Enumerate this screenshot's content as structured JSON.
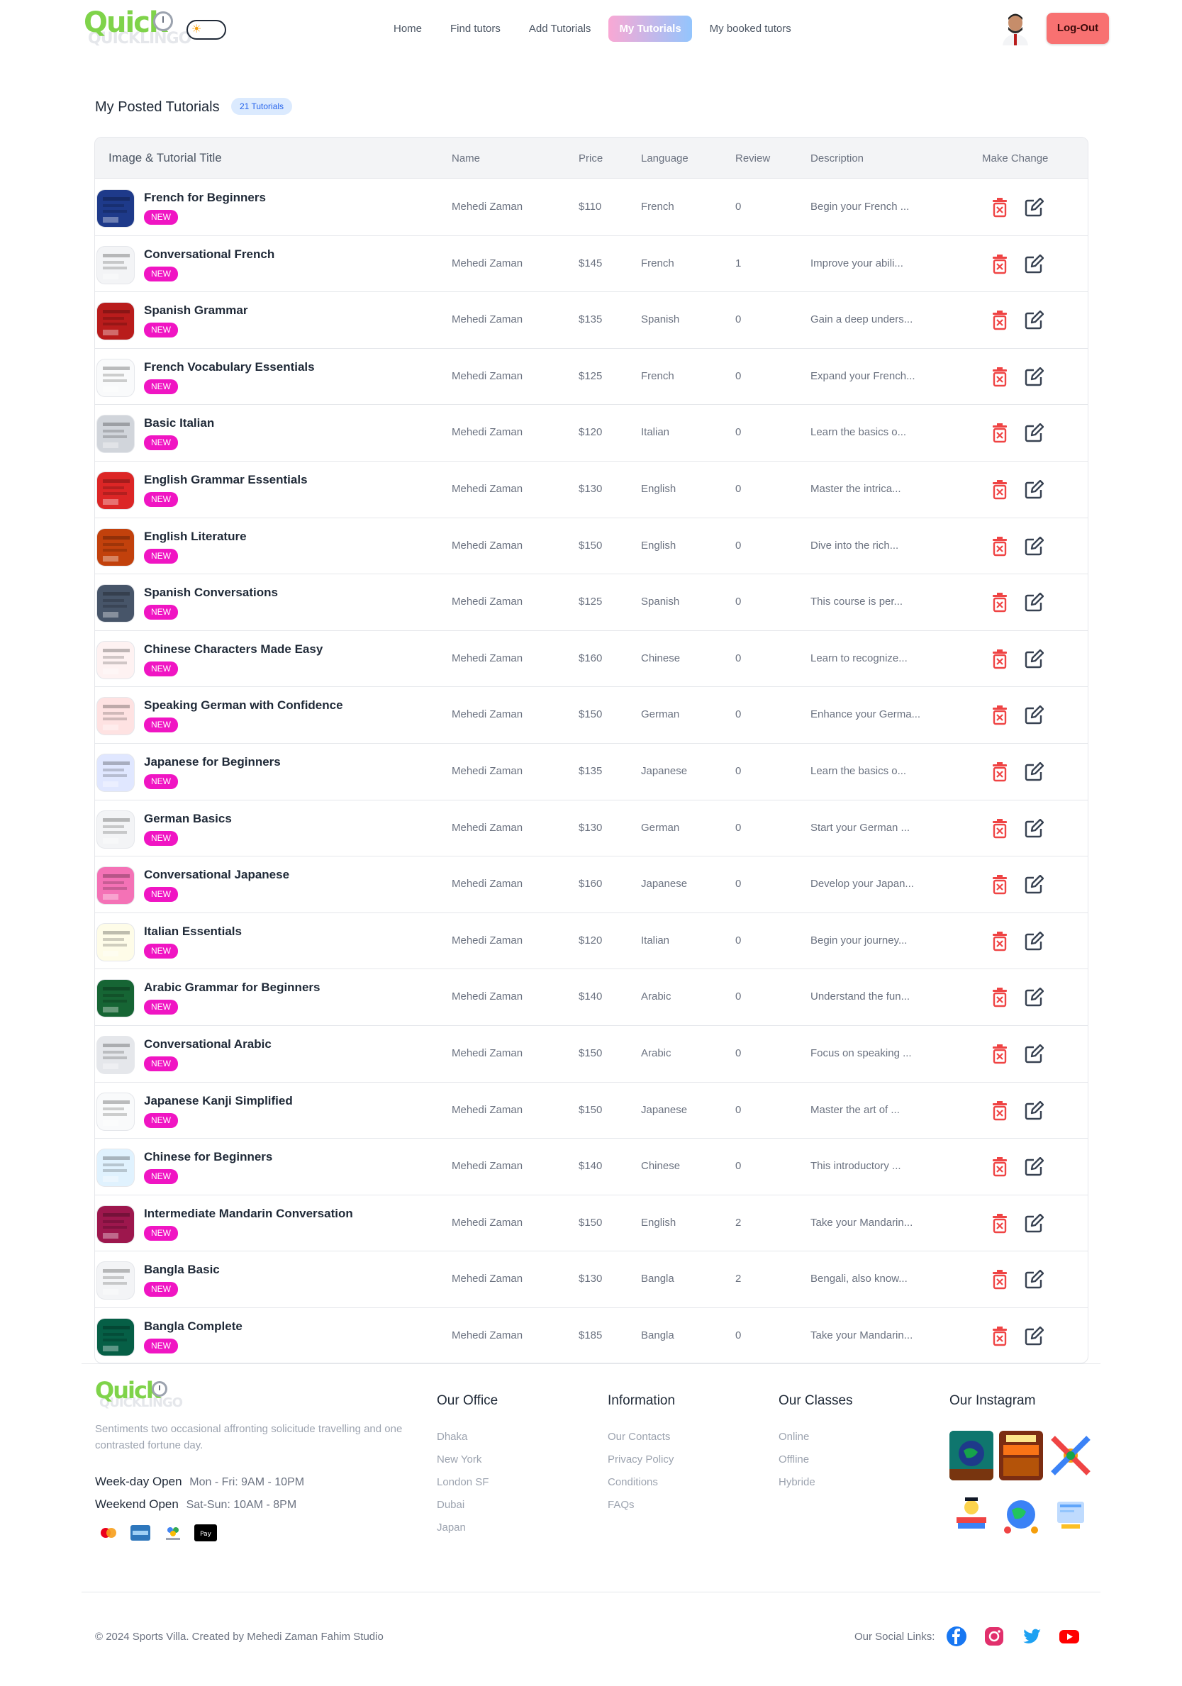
{
  "nav": {
    "logo_text": "Quick",
    "logo_sub": "QUICKLINGO",
    "links": [
      "Home",
      "Find tutors",
      "Add Tutorials",
      "My Tutorials",
      "My booked tutors"
    ],
    "active_index": 3,
    "logout_label": "Log-Out"
  },
  "page": {
    "title": "My Posted Tutorials",
    "count_badge": "21 Tutorials"
  },
  "table": {
    "headers": [
      "Image & Tutorial Title",
      "Name",
      "Price",
      "Language",
      "Review",
      "Description",
      "Make Change"
    ],
    "new_label": "NEW",
    "rows": [
      {
        "title": "French for Beginners",
        "name": "Mehedi Zaman",
        "price": "$110",
        "language": "French",
        "review": "0",
        "description": "Begin your French ...",
        "thumb_color": "#1e3a8a"
      },
      {
        "title": "Conversational French",
        "name": "Mehedi Zaman",
        "price": "$145",
        "language": "French",
        "review": "1",
        "description": "Improve your abili...",
        "thumb_color": "#f3f4f6"
      },
      {
        "title": "Spanish Grammar",
        "name": "Mehedi Zaman",
        "price": "$135",
        "language": "Spanish",
        "review": "0",
        "description": "Gain a deep unders...",
        "thumb_color": "#b91c1c"
      },
      {
        "title": "French Vocabulary Essentials",
        "name": "Mehedi Zaman",
        "price": "$125",
        "language": "French",
        "review": "0",
        "description": "Expand your French...",
        "thumb_color": "#f9fafb"
      },
      {
        "title": "Basic Italian",
        "name": "Mehedi Zaman",
        "price": "$120",
        "language": "Italian",
        "review": "0",
        "description": "Learn the basics o...",
        "thumb_color": "#d1d5db"
      },
      {
        "title": "English Grammar Essentials",
        "name": "Mehedi Zaman",
        "price": "$130",
        "language": "English",
        "review": "0",
        "description": "Master the intrica...",
        "thumb_color": "#dc2626"
      },
      {
        "title": "English Literature",
        "name": "Mehedi Zaman",
        "price": "$150",
        "language": "English",
        "review": "0",
        "description": "Dive into the rich...",
        "thumb_color": "#c2410c"
      },
      {
        "title": "Spanish Conversations",
        "name": "Mehedi Zaman",
        "price": "$125",
        "language": "Spanish",
        "review": "0",
        "description": "This course is per...",
        "thumb_color": "#475569"
      },
      {
        "title": "Chinese Characters Made Easy",
        "name": "Mehedi Zaman",
        "price": "$160",
        "language": "Chinese",
        "review": "0",
        "description": "Learn to recognize...",
        "thumb_color": "#fef2f2"
      },
      {
        "title": "Speaking German with Confidence",
        "name": "Mehedi Zaman",
        "price": "$150",
        "language": "German",
        "review": "0",
        "description": "Enhance your Germa...",
        "thumb_color": "#fee2e2"
      },
      {
        "title": "Japanese for Beginners",
        "name": "Mehedi Zaman",
        "price": "$135",
        "language": "Japanese",
        "review": "0",
        "description": "Learn the basics o...",
        "thumb_color": "#e0e7ff"
      },
      {
        "title": "German Basics",
        "name": "Mehedi Zaman",
        "price": "$130",
        "language": "German",
        "review": "0",
        "description": "Start your German ...",
        "thumb_color": "#f3f4f6"
      },
      {
        "title": "Conversational Japanese",
        "name": "Mehedi Zaman",
        "price": "$160",
        "language": "Japanese",
        "review": "0",
        "description": "Develop your Japan...",
        "thumb_color": "#f472b6"
      },
      {
        "title": "Italian Essentials",
        "name": "Mehedi Zaman",
        "price": "$120",
        "language": "Italian",
        "review": "0",
        "description": "Begin your journey...",
        "thumb_color": "#fefce8"
      },
      {
        "title": "Arabic Grammar for Beginners",
        "name": "Mehedi Zaman",
        "price": "$140",
        "language": "Arabic",
        "review": "0",
        "description": "Understand the fun...",
        "thumb_color": "#166534"
      },
      {
        "title": "Conversational Arabic",
        "name": "Mehedi Zaman",
        "price": "$150",
        "language": "Arabic",
        "review": "0",
        "description": "Focus on speaking ...",
        "thumb_color": "#e5e7eb"
      },
      {
        "title": "Japanese Kanji Simplified",
        "name": "Mehedi Zaman",
        "price": "$150",
        "language": "Japanese",
        "review": "0",
        "description": "Master the art of ...",
        "thumb_color": "#f9fafb"
      },
      {
        "title": "Chinese for Beginners",
        "name": "Mehedi Zaman",
        "price": "$140",
        "language": "Chinese",
        "review": "0",
        "description": "This introductory ...",
        "thumb_color": "#e0f2fe"
      },
      {
        "title": "Intermediate Mandarin Conversation",
        "name": "Mehedi Zaman",
        "price": "$150",
        "language": "English",
        "review": "2",
        "description": "Take your Mandarin...",
        "thumb_color": "#9d174d"
      },
      {
        "title": "Bangla Basic",
        "name": "Mehedi Zaman",
        "price": "$130",
        "language": "Bangla",
        "review": "2",
        "description": "Bengali, also know...",
        "thumb_color": "#f3f4f6"
      },
      {
        "title": "Bangla Complete",
        "name": "Mehedi Zaman",
        "price": "$185",
        "language": "Bangla",
        "review": "0",
        "description": "Take your Mandarin...",
        "thumb_color": "#065f46"
      }
    ]
  },
  "footer": {
    "about": "Sentiments two occasional affronting solicitude travelling and one contrasted fortune day.",
    "weekday_label": "Week-day Open",
    "weekday_value": "Mon - Fri: 9AM - 10PM",
    "weekend_label": "Weekend Open",
    "weekend_value": "Sat-Sun: 10AM - 8PM",
    "columns": [
      {
        "title": "Our Office",
        "links": [
          "Dhaka",
          "New York",
          "London SF",
          "Dubai",
          "Japan"
        ]
      },
      {
        "title": "Information",
        "links": [
          "Our Contacts",
          "Privacy Policy",
          "Conditions",
          "FAQs"
        ]
      },
      {
        "title": "Our Classes",
        "links": [
          "Online",
          "Offline",
          "Hybride"
        ]
      }
    ],
    "instagram_title": "Our Instagram",
    "copyright": "© 2024 Sports Villa. Created by Mehedi Zaman Fahim Studio",
    "social_label": "Our Social Links:",
    "colors": {
      "accent_new": "#f015c3",
      "delete": "#ef4444",
      "logout": "#f87171"
    }
  }
}
